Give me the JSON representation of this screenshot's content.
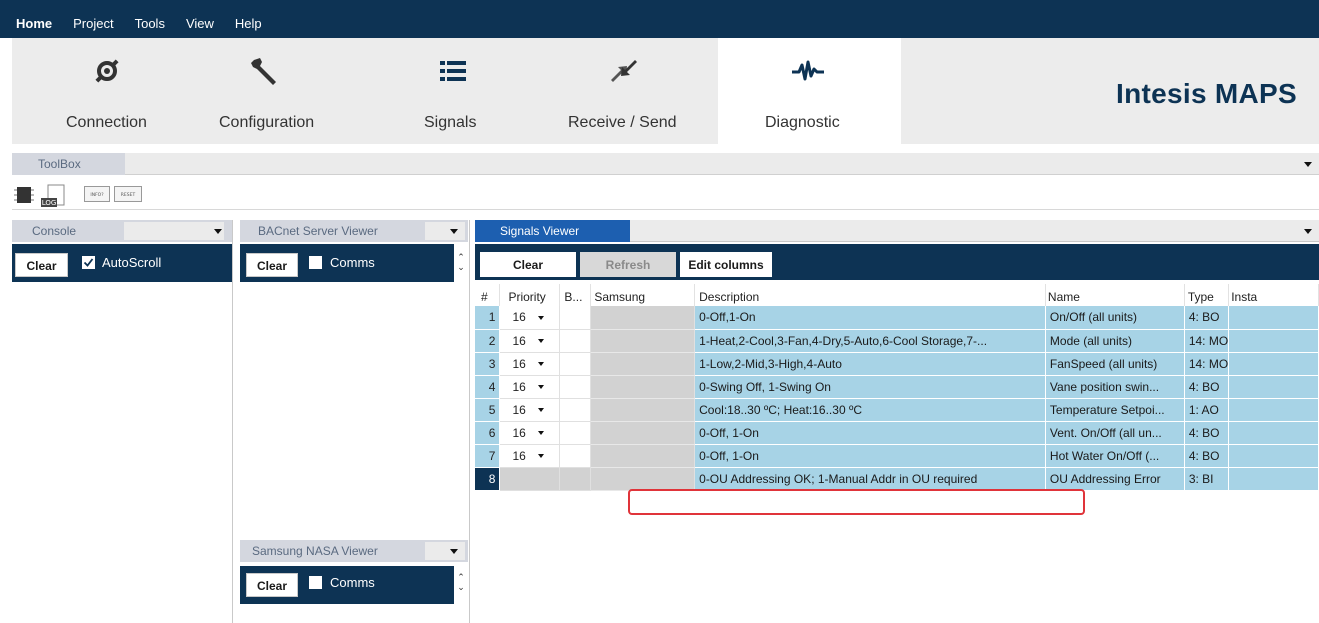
{
  "menu": [
    "Home",
    "Project",
    "Tools",
    "View",
    "Help"
  ],
  "ribbon": {
    "tabs": [
      {
        "label": "Connection",
        "icon": "connection-plug-icon"
      },
      {
        "label": "Configuration",
        "icon": "wrench-icon"
      },
      {
        "label": "Signals",
        "icon": "list-icon"
      },
      {
        "label": "Receive / Send",
        "icon": "transfer-arrows-icon"
      },
      {
        "label": "Diagnostic",
        "icon": "waveform-icon"
      }
    ],
    "active": "Diagnostic",
    "brand": "Intesis MAPS"
  },
  "toolbox": {
    "title": "ToolBox",
    "icons": [
      "chip-icon",
      "log-icon",
      "info-button-icon",
      "reset-button-icon"
    ],
    "icon_texts": {
      "log": "LOG",
      "info": "INFO?",
      "reset": "RESET"
    }
  },
  "console": {
    "title": "Console",
    "clear": "Clear",
    "autoscroll": "AutoScroll",
    "autoscroll_checked": true
  },
  "bacnet": {
    "title": "BACnet Server Viewer",
    "clear": "Clear",
    "comms": "Comms"
  },
  "nasa": {
    "title": "Samsung NASA Viewer",
    "clear": "Clear",
    "comms": "Comms"
  },
  "signals_viewer": {
    "title": "Signals Viewer",
    "buttons": {
      "clear": "Clear",
      "refresh": "Refresh",
      "edit_columns": "Edit columns"
    },
    "columns": [
      "#",
      "Priority",
      "B...",
      "Samsung",
      "Description",
      "Name",
      "Type",
      "Insta"
    ],
    "rows": [
      {
        "num": "1",
        "priority": "16",
        "description": "0-Off,1-On",
        "name": "On/Off (all units)",
        "type": "4: BO"
      },
      {
        "num": "2",
        "priority": "16",
        "description": "1-Heat,2-Cool,3-Fan,4-Dry,5-Auto,6-Cool Storage,7-...",
        "name": "Mode (all units)",
        "type": "14: MO"
      },
      {
        "num": "3",
        "priority": "16",
        "description": "1-Low,2-Mid,3-High,4-Auto",
        "name": "FanSpeed (all units)",
        "type": "14: MO"
      },
      {
        "num": "4",
        "priority": "16",
        "description": "0-Swing Off, 1-Swing On",
        "name": "Vane position swin...",
        "type": "4: BO"
      },
      {
        "num": "5",
        "priority": "16",
        "description": "Cool:18..30 ºC; Heat:16..30 ºC",
        "name": "Temperature Setpoi...",
        "type": "1: AO"
      },
      {
        "num": "6",
        "priority": "16",
        "description": "0-Off, 1-On",
        "name": "Vent. On/Off (all un...",
        "type": "4: BO"
      },
      {
        "num": "7",
        "priority": "16",
        "description": "0-Off, 1-On",
        "name": "Hot Water On/Off (...",
        "type": "4: BO"
      },
      {
        "num": "8",
        "priority": "",
        "description": "0-OU Addressing OK; 1-Manual Addr in OU required",
        "name": "OU Addressing Error",
        "type": "3: BI"
      }
    ],
    "selected_row": "8"
  },
  "colors": {
    "navy": "#0d3354",
    "row_blue": "#a7d3e6",
    "tab_blue": "#1d5fb0",
    "highlight": "#e0343a"
  }
}
